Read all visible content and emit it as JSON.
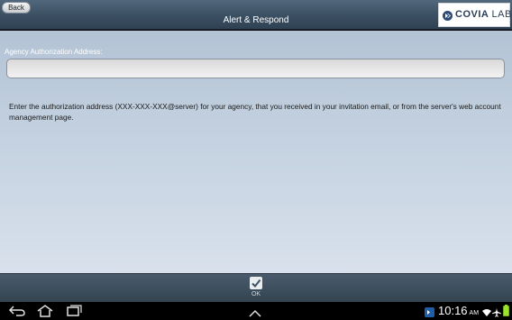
{
  "header": {
    "back_label": "Back",
    "title": "Alert & Respond",
    "logo": {
      "text_bold": "COVIA",
      "text_thin": "LABS",
      "brand_color": "#2c3e57"
    }
  },
  "form": {
    "field_label": "Agency Authorization Address:",
    "field_value": "",
    "help_text": "Enter the authorization address (XXX-XXX-XXX@server) for your agency, that you received in your invitation email, or from the server's web account management page."
  },
  "actionbar": {
    "ok_label": "OK"
  },
  "systembar": {
    "time": "10:16",
    "time_suffix": "AM",
    "icons": [
      "back-icon",
      "home-icon",
      "recent-apps-icon",
      "up-chevron-icon",
      "app-notification-icon",
      "wifi-icon",
      "airplane-icon",
      "battery-icon"
    ]
  }
}
